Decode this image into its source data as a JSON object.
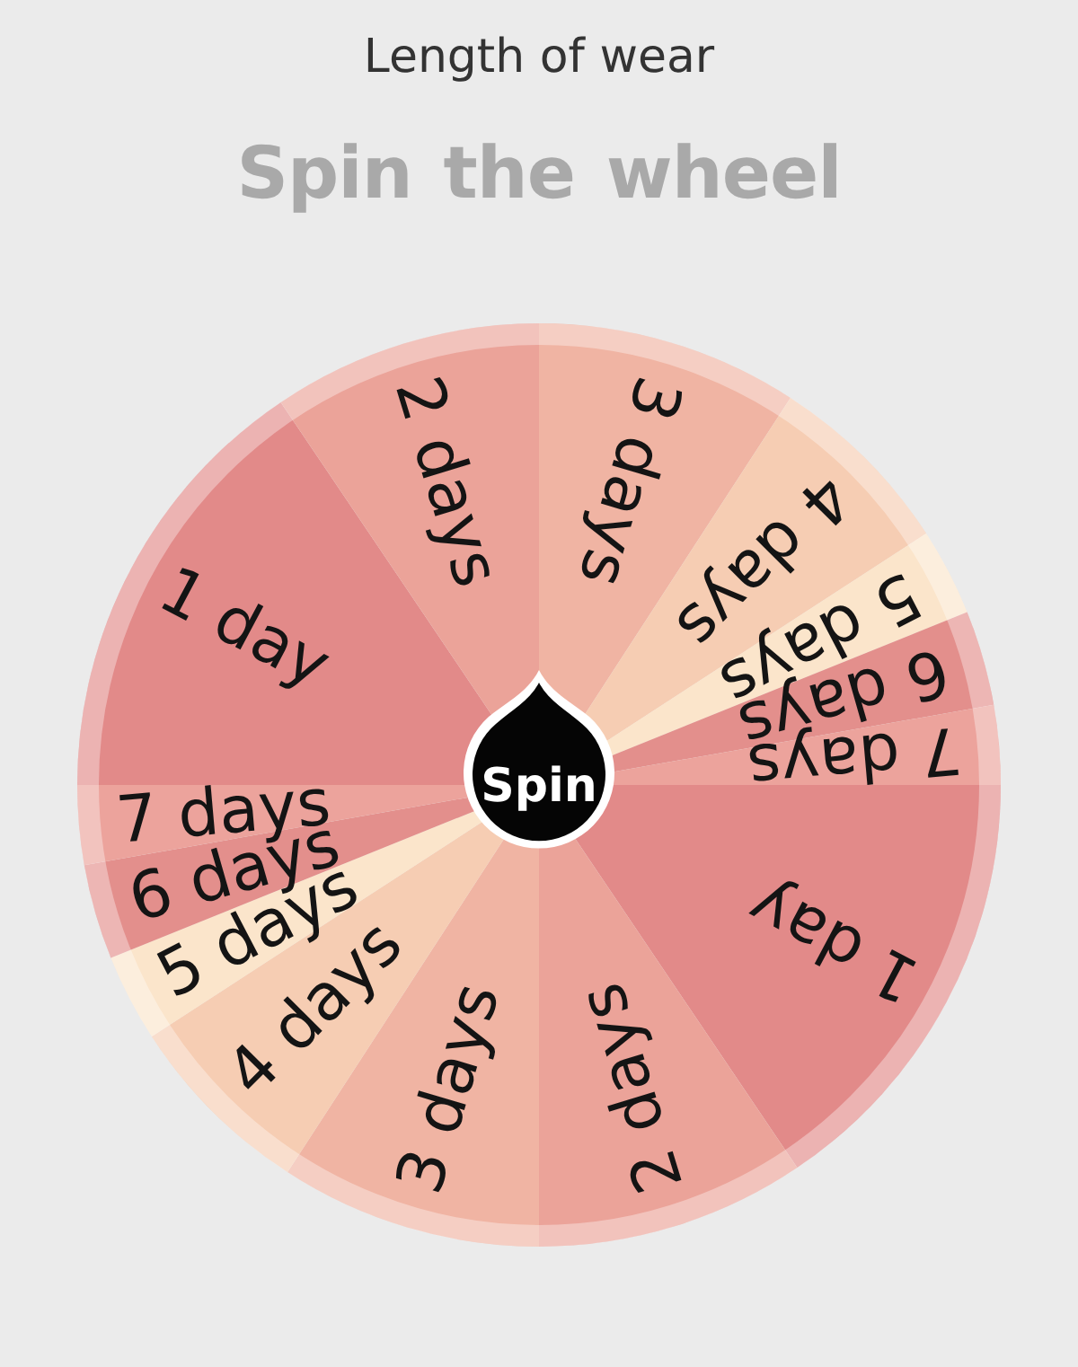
{
  "title": "Length of wear",
  "heading": "Spin the wheel",
  "wheel": {
    "segments": [
      {
        "label": "3 days",
        "color": "#f0b4a3"
      },
      {
        "label": "4 days",
        "color": "#f6cdb3"
      },
      {
        "label": "5 days",
        "color": "#fbe5cb"
      },
      {
        "label": "6 days",
        "color": "#e38f8c"
      },
      {
        "label": "7 days",
        "color": "#eca39c"
      },
      {
        "label": "1 day",
        "color": "#e28a89"
      },
      {
        "label": "2 days",
        "color": "#eba399"
      },
      {
        "label": "3 days",
        "color": "#f0b4a3"
      },
      {
        "label": "4 days",
        "color": "#f6cdb3"
      },
      {
        "label": "5 days",
        "color": "#fbe5cb"
      },
      {
        "label": "6 days",
        "color": "#e38f8c"
      },
      {
        "label": "7 days",
        "color": "#eca39c"
      },
      {
        "label": "1 day",
        "color": "#e28a89"
      },
      {
        "label": "2 days",
        "color": "#eba399"
      }
    ],
    "spin_button": "Spin"
  }
}
